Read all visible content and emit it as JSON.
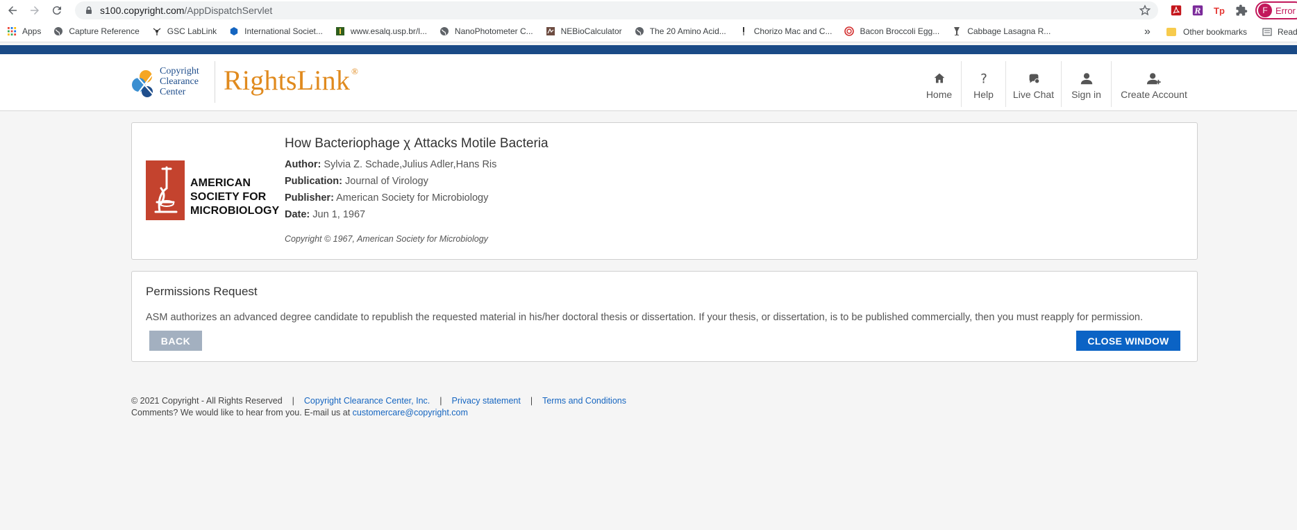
{
  "browser": {
    "url_host": "s100.copyright.com",
    "url_path": "/AppDispatchServlet",
    "profile_initial": "F",
    "profile_status": "Error",
    "extensions": [
      "adobe-pdf-icon",
      "zotero-icon",
      "tp-icon",
      "puzzle-icon"
    ],
    "bookmarks": [
      {
        "label": "Apps",
        "icon": "apps-grid-icon"
      },
      {
        "label": "Capture Reference",
        "icon": "globe-icon"
      },
      {
        "label": "GSC LabLink",
        "icon": "molecule-icon"
      },
      {
        "label": "International Societ...",
        "icon": "hexagon-icon"
      },
      {
        "label": "www.esalq.usp.br/l...",
        "icon": "esalq-icon"
      },
      {
        "label": "NanoPhotometer C...",
        "icon": "globe-icon"
      },
      {
        "label": "NEBioCalculator",
        "icon": "neb-icon"
      },
      {
        "label": "The 20 Amino Acid...",
        "icon": "globe-icon"
      },
      {
        "label": "Chorizo Mac and C...",
        "icon": "pin-icon"
      },
      {
        "label": "Bacon Broccoli Egg...",
        "icon": "spiral-icon"
      },
      {
        "label": "Cabbage Lasagna R...",
        "icon": "glass-icon"
      }
    ],
    "overflow_label": "»",
    "other_bookmarks": "Other bookmarks",
    "reading_list": "Read"
  },
  "header": {
    "ccc_lines": [
      "Copyright",
      "Clearance",
      "Center"
    ],
    "brand": "RightsLink",
    "brand_mark": "®",
    "nav": [
      {
        "label": "Home",
        "icon": "home-icon"
      },
      {
        "label": "Help",
        "icon": "help-icon"
      },
      {
        "label": "Live Chat",
        "icon": "chat-icon"
      },
      {
        "label": "Sign in",
        "icon": "user-icon"
      },
      {
        "label": "Create Account",
        "icon": "add-user-icon"
      }
    ]
  },
  "article": {
    "publisher_logo_lines": [
      "AMERICAN",
      "SOCIETY FOR",
      "MICROBIOLOGY"
    ],
    "title": "How Bacteriophage χ Attacks Motile Bacteria",
    "author_label": "Author:",
    "author": "Sylvia Z. Schade,Julius Adler,Hans Ris",
    "publication_label": "Publication:",
    "publication": "Journal of Virology",
    "publisher_label": "Publisher:",
    "publisher": "American Society for Microbiology",
    "date_label": "Date:",
    "date": "Jun 1, 1967",
    "copyright": "Copyright © 1967, American Society for Microbiology"
  },
  "permissions": {
    "heading": "Permissions Request",
    "text": "ASM authorizes an advanced degree candidate to republish the requested material in his/her doctoral thesis or dissertation. If your thesis, or dissertation, is to be published commercially, then you must reapply for permission.",
    "back_label": "BACK",
    "close_label": "CLOSE WINDOW"
  },
  "footer": {
    "copyright": "© 2021 Copyright - All Rights Reserved",
    "links": [
      "Copyright Clearance Center, Inc.",
      "Privacy statement",
      "Terms and Conditions"
    ],
    "separator": "|",
    "comments_text": "Comments? We would like to hear from you. E-mail us at",
    "email": "customercare@copyright.com"
  },
  "colors": {
    "brand_blue": "#1a4a86",
    "rightslink_orange": "#e08a1e",
    "asm_red": "#c4432e",
    "primary_button": "#0b63c5",
    "secondary_button": "#a3b0c0",
    "link": "#1565c0"
  }
}
